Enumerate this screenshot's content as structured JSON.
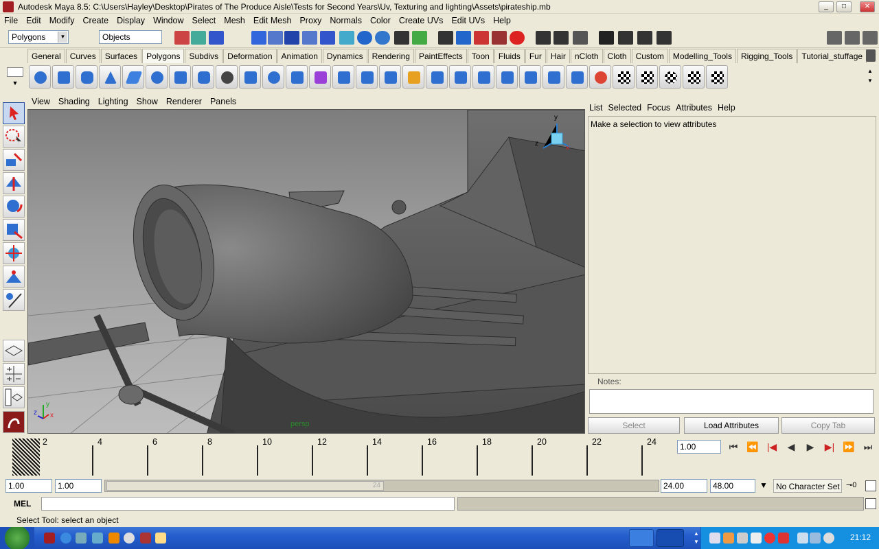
{
  "window": {
    "title": "Autodesk Maya 8.5: C:\\Users\\Hayley\\Desktop\\Pirates of The Produce Aisle\\Tests for Second Years\\Uv, Texturing and lighting\\Assets\\pirateship.mb",
    "min": "_",
    "max": "□",
    "close": "✕"
  },
  "menu": [
    "File",
    "Edit",
    "Modify",
    "Create",
    "Display",
    "Window",
    "Select",
    "Mesh",
    "Edit Mesh",
    "Proxy",
    "Normals",
    "Color",
    "Create UVs",
    "Edit UVs",
    "Help"
  ],
  "toolbar": {
    "menuset": "Polygons",
    "objects": "Objects"
  },
  "shelf_tabs": [
    "General",
    "Curves",
    "Surfaces",
    "Polygons",
    "Subdivs",
    "Deformation",
    "Animation",
    "Dynamics",
    "Rendering",
    "PaintEffects",
    "Toon",
    "Fluids",
    "Fur",
    "Hair",
    "nCloth",
    "Cloth",
    "Custom",
    "Modelling_Tools",
    "Rigging_Tools",
    "Tutorial_stuffage"
  ],
  "shelf_active": "Polygons",
  "viewport": {
    "menu": [
      "View",
      "Shading",
      "Lighting",
      "Show",
      "Renderer",
      "Panels"
    ],
    "camera": "persp",
    "axis": {
      "x": "x",
      "y": "y",
      "z": "z"
    }
  },
  "attr": {
    "menu": [
      "List",
      "Selected",
      "Focus",
      "Attributes",
      "Help"
    ],
    "message": "Make a selection to view attributes",
    "notes_label": "Notes:",
    "select": "Select",
    "load": "Load Attributes",
    "copy": "Copy Tab"
  },
  "timeline": {
    "labels": [
      "2",
      "4",
      "6",
      "8",
      "10",
      "12",
      "14",
      "16",
      "18",
      "20",
      "22",
      "24"
    ],
    "current": "1.00"
  },
  "range": {
    "start": "1.00",
    "play_start": "1.00",
    "slider_end": "24",
    "play_end": "24.00",
    "end": "48.00",
    "charset": "No Character Set"
  },
  "cmd": {
    "label": "MEL"
  },
  "helpline": "Select Tool: select an object",
  "clock": "21:12",
  "colors": {
    "chrome": "#ece9d8",
    "viewport": "#9a9a9a",
    "taskbar": "#245ecd"
  }
}
